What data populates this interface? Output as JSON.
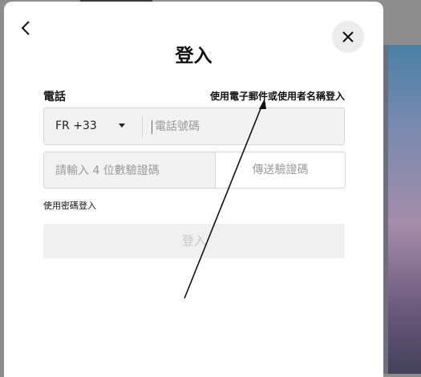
{
  "dialog": {
    "title": "登入",
    "phone_label": "電話",
    "switch_link": "使用電子郵件或使用者名稱登入",
    "country_code": "FR +33",
    "phone_placeholder": "電話號碼",
    "code_placeholder": "請輸入 4 位數驗證碼",
    "send_code_label": "傳送驗證碼",
    "password_login_link": "使用密碼登入",
    "login_button_label": "登入"
  },
  "icons": {
    "back": "chevron-left-icon",
    "close": "close-icon",
    "dropdown": "caret-down-icon"
  }
}
